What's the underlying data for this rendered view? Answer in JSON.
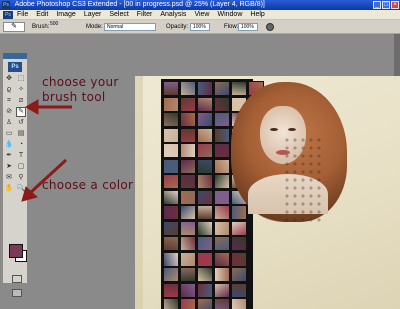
{
  "window": {
    "title": "Adobe Photoshop CS3 Extended - [00 in progress.psd @ 25% (Layer 4, RGB/8)]",
    "app_badge": "Ps"
  },
  "menubar": {
    "items": [
      "File",
      "Edit",
      "Image",
      "Layer",
      "Select",
      "Filter",
      "Analysis",
      "View",
      "Window",
      "Help"
    ]
  },
  "options": {
    "brush_label": "Brush:",
    "brush_size": "500",
    "mode_label": "Mode:",
    "mode_value": "Normal",
    "opacity_label": "Opacity:",
    "opacity_value": "100%",
    "flow_label": "Flow:",
    "flow_value": "100%"
  },
  "toolbox": {
    "logo": "Ps",
    "foreground_color": "#7a3a55",
    "background_color": "#ffffff",
    "selected_tool": "brush-tool"
  },
  "annotations": {
    "brush_line1": "choose your",
    "brush_line2": "brush tool",
    "color": "choose a color",
    "arrow_color": "#8b1a1a"
  }
}
